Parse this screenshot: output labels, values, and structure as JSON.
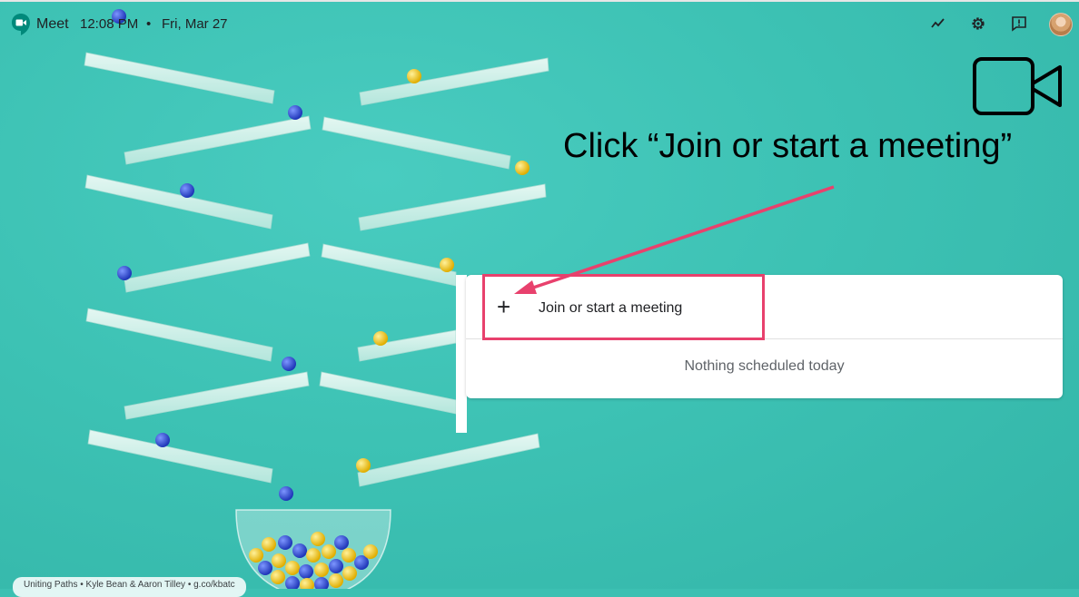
{
  "header": {
    "app_name": "Meet",
    "time": "12:08 PM",
    "separator": "•",
    "date": "Fri, Mar 27",
    "icons": [
      "trend-icon",
      "gear-icon",
      "feedback-icon",
      "avatar"
    ]
  },
  "annotation": {
    "text": "Click “Join or start a meeting”",
    "highlight_color": "#e8416d"
  },
  "card": {
    "join_icon": "+",
    "join_label": "Join or start a meeting",
    "empty_label": "Nothing scheduled today"
  },
  "credit": {
    "text": "Uniting Paths  •  Kyle Bean & Aaron Tilley  •  g.co/kbatc"
  },
  "colors": {
    "background": "#3cc0b2",
    "accent": "#e8416d",
    "marble_blue": "#2f4fcf",
    "marble_yellow": "#f2c615"
  }
}
